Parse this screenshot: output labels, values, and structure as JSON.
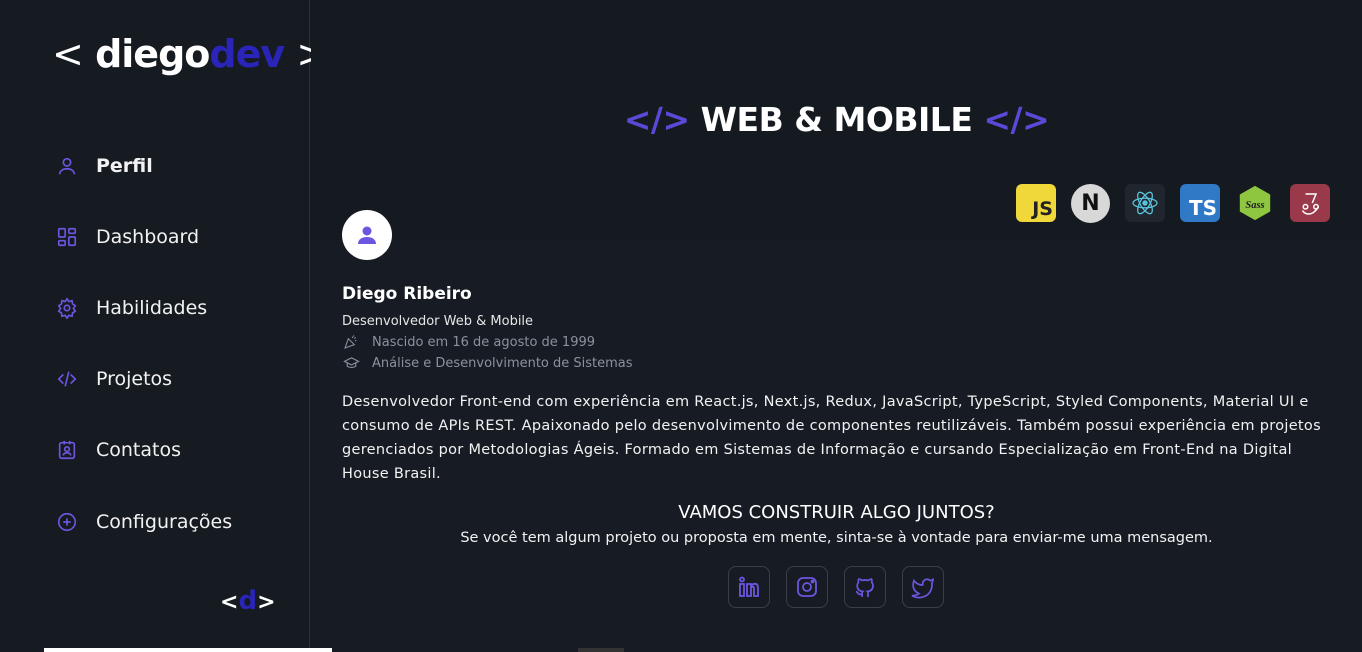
{
  "logo": {
    "open": "<",
    "name": "diego",
    "accent": "dev",
    "close": ">"
  },
  "nav": {
    "items": [
      {
        "label": "Perfil",
        "icon": "user-icon",
        "active": true
      },
      {
        "label": "Dashboard",
        "icon": "dashboard-icon",
        "active": false
      },
      {
        "label": "Habilidades",
        "icon": "gear-icon",
        "active": false
      },
      {
        "label": "Projetos",
        "icon": "code-icon",
        "active": false
      },
      {
        "label": "Contatos",
        "icon": "contact-card-icon",
        "active": false
      },
      {
        "label": "Configurações",
        "icon": "plus-circle-icon",
        "active": false
      }
    ]
  },
  "mini_logo": {
    "open": "<",
    "letter": "d",
    "close": ">"
  },
  "banner": {
    "code_open": "</>",
    "title": "WEB & MOBILE",
    "code_close": "</>",
    "tech": [
      {
        "name": "js-icon",
        "label": "JS"
      },
      {
        "name": "nextjs-icon",
        "label": "N"
      },
      {
        "name": "react-icon",
        "label": ""
      },
      {
        "name": "typescript-icon",
        "label": "TS"
      },
      {
        "name": "sass-icon",
        "label": ""
      },
      {
        "name": "jest-icon",
        "label": ""
      }
    ]
  },
  "profile": {
    "name": "Diego Ribeiro",
    "role": "Desenvolvedor Web & Mobile",
    "birth": "Nascido em 16 de agosto de 1999",
    "education": "Análise e Desenvolvimento de Sistemas",
    "bio": "Desenvolvedor Front-end com experiência em React.js, Next.js, Redux, JavaScript, TypeScript, Styled Components, Material UI e consumo de APIs REST. Apaixonado pelo desenvolvimento de componentes reutilizáveis. Também possui experiência em projetos gerenciados por Metodologias Ágeis. Formado em Sistemas de Informação e cursando Especialização em Front-End na Digital House Brasil."
  },
  "cta": {
    "title": "VAMOS CONSTRUIR ALGO JUNTOS?",
    "subtitle": "Se você tem algum projeto ou proposta em mente, sinta-se à vontade para enviar-me uma mensagem."
  },
  "socials": [
    "linkedin-icon",
    "instagram-icon",
    "github-icon",
    "twitter-icon"
  ],
  "colors": {
    "accent": "#5a49d6",
    "logo_accent": "#2a24b8",
    "background": "#161b22"
  }
}
